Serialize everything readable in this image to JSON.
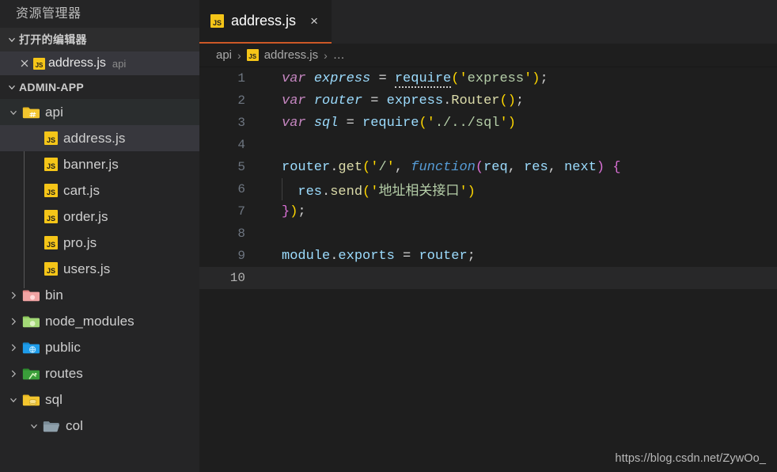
{
  "sidebar": {
    "title": "资源管理器",
    "open_editors": {
      "header": "打开的编辑器",
      "items": [
        {
          "name": "address.js",
          "description": "api",
          "icon": "js-file-icon",
          "close": "×"
        }
      ]
    },
    "workspace": {
      "header": "ADMIN-APP",
      "tree": [
        {
          "label": "api",
          "type": "folder",
          "icon": "folder-api-icon",
          "expanded": true,
          "depth": 1,
          "state": "active"
        },
        {
          "label": "address.js",
          "type": "file",
          "icon": "js-file-icon",
          "depth": 2,
          "state": "selected"
        },
        {
          "label": "banner.js",
          "type": "file",
          "icon": "js-file-icon",
          "depth": 2,
          "state": "normal"
        },
        {
          "label": "cart.js",
          "type": "file",
          "icon": "js-file-icon",
          "depth": 2,
          "state": "normal"
        },
        {
          "label": "order.js",
          "type": "file",
          "icon": "js-file-icon",
          "depth": 2,
          "state": "normal"
        },
        {
          "label": "pro.js",
          "type": "file",
          "icon": "js-file-icon",
          "depth": 2,
          "state": "normal"
        },
        {
          "label": "users.js",
          "type": "file",
          "icon": "js-file-icon",
          "depth": 2,
          "state": "normal"
        },
        {
          "label": "bin",
          "type": "folder",
          "icon": "folder-bin-icon",
          "expanded": false,
          "depth": 1,
          "state": "normal"
        },
        {
          "label": "node_modules",
          "type": "folder",
          "icon": "folder-node-icon",
          "expanded": false,
          "depth": 1,
          "state": "normal"
        },
        {
          "label": "public",
          "type": "folder",
          "icon": "folder-public-icon",
          "expanded": false,
          "depth": 1,
          "state": "normal"
        },
        {
          "label": "routes",
          "type": "folder",
          "icon": "folder-routes-icon",
          "expanded": false,
          "depth": 1,
          "state": "normal"
        },
        {
          "label": "sql",
          "type": "folder",
          "icon": "folder-sql-icon",
          "expanded": true,
          "depth": 1,
          "state": "normal"
        },
        {
          "label": "col",
          "type": "folder",
          "icon": "folder-open-icon",
          "expanded": true,
          "depth": 2,
          "state": "normal"
        }
      ]
    }
  },
  "editor": {
    "tabs": [
      {
        "label": "address.js",
        "icon": "js-file-icon",
        "close_label": "×",
        "active": true
      }
    ],
    "breadcrumbs": {
      "items": [
        "api",
        "address.js",
        "…"
      ],
      "separator": "›",
      "file_icon": "js-file-icon"
    },
    "current_line": 10,
    "line_count": 10,
    "code": {
      "lines": [
        {
          "n": "1",
          "text": "var express = require('express');"
        },
        {
          "n": "2",
          "text": "var router = express.Router();"
        },
        {
          "n": "3",
          "text": "var sql = require('./../sql')"
        },
        {
          "n": "4",
          "text": ""
        },
        {
          "n": "5",
          "text": "router.get('/', function(req, res, next) {"
        },
        {
          "n": "6",
          "text": "  res.send('地址相关接口')"
        },
        {
          "n": "7",
          "text": "});"
        },
        {
          "n": "8",
          "text": ""
        },
        {
          "n": "9",
          "text": "module.exports = router;"
        },
        {
          "n": "10",
          "text": ""
        }
      ]
    }
  },
  "watermark": "https://blog.csdn.net/ZywOo_",
  "colors": {
    "sidebar_bg": "#252526",
    "editor_bg": "#1e1e1e",
    "selection_bg": "#37373d",
    "hover_bg": "#2a2d2e",
    "tab_accent": "#cc5827",
    "js_icon_bg": "#f5c518",
    "keyword": "#c586c0",
    "variable": "#9cdcfe",
    "function": "#dcdcaa",
    "string": "#b5cea8",
    "bracket1": "#ffd700",
    "bracket2": "#da70d6",
    "line_number": "#6e7681",
    "current_line_bg": "#282829"
  }
}
